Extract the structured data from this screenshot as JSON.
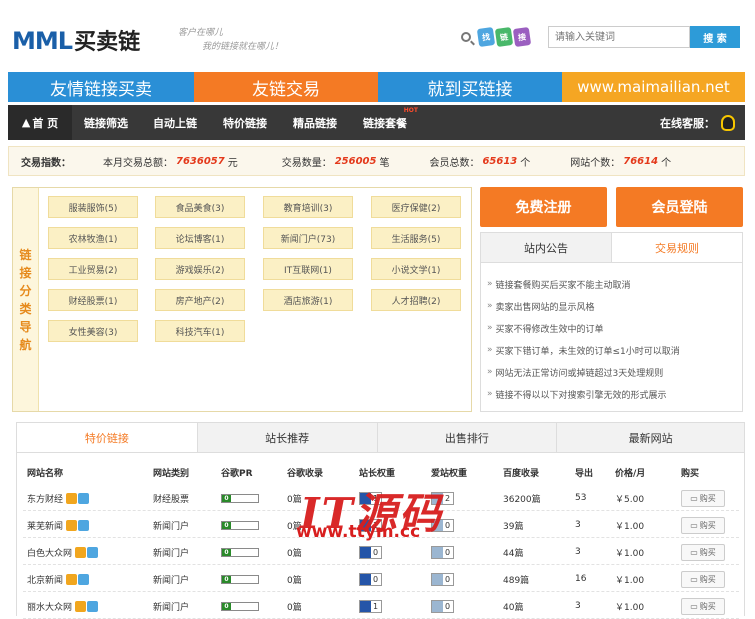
{
  "header": {
    "logo": "MML",
    "logo_cn": "买卖链",
    "slogan_1": "客户在哪儿",
    "slogan_2": "我的链接就在哪儿！",
    "pills": [
      "找",
      "链",
      "接"
    ],
    "search_placeholder": "请输入关键词",
    "search_button": "搜 索"
  },
  "banners": [
    {
      "label": "友情链接买卖",
      "color": "#2a8fd6"
    },
    {
      "label": "友链交易",
      "color": "#f47a24"
    },
    {
      "label": "就到买链接",
      "color": "#2a8fd6"
    },
    {
      "label": "www.maimailian.net",
      "color": "#f5a623"
    }
  ],
  "nav": {
    "home": "首 页",
    "items": [
      "链接筛选",
      "自动上链",
      "特价链接",
      "精品链接",
      "链接套餐"
    ],
    "hot": "HOT",
    "service": "在线客服："
  },
  "stats": {
    "label": "交易指数：",
    "month_total_label": "本月交易总额：",
    "month_total": "7636057",
    "month_unit": "元",
    "count_label": "交易数量：",
    "count": "256005",
    "count_unit": "笔",
    "members_label": "会员总数：",
    "members": "65613",
    "members_unit": "个",
    "sites_label": "网站个数：",
    "sites": "76614",
    "sites_unit": "个"
  },
  "categories": {
    "side_label": "链接分类导航",
    "items": [
      "服装服饰(5)",
      "食品美食(3)",
      "教育培训(3)",
      "医疗保健(2)",
      "农林牧渔(1)",
      "论坛博客(1)",
      "新闻门户(73)",
      "生活服务(5)",
      "工业贸易(2)",
      "游戏娱乐(2)",
      "IT互联网(1)",
      "小说文学(1)",
      "财经股票(1)",
      "房产地产(2)",
      "酒店旅游(1)",
      "人才招聘(2)",
      "女性美容(3)",
      "科技汽车(1)"
    ]
  },
  "right_panel": {
    "register": "免费注册",
    "login": "会员登陆",
    "tabs": [
      "站内公告",
      "交易规则"
    ],
    "rules": [
      "链接套餐购买后买家不能主动取消",
      "卖家出售网站的显示风格",
      "买家不得修改生效中的订单",
      "买家下错订单，未生效的订单≤1小时可以取消",
      "网站无法正常访问或掉链超过3天处理规则",
      "链接不得以以下对搜索引擎无效的形式展示"
    ]
  },
  "table": {
    "tabs": [
      "特价链接",
      "站长推荐",
      "出售排行",
      "最新网站"
    ],
    "headers": [
      "网站名称",
      "网站类别",
      "谷歌PR",
      "谷歌收录",
      "站长权重",
      "爱站权重",
      "百度收录",
      "导出",
      "价格/月",
      "购买"
    ],
    "rows": [
      {
        "name": "东方财经",
        "category": "财经股票",
        "pr": "0",
        "google": "0篇",
        "zz": "1",
        "az": "2",
        "baidu": "36200篇",
        "export": "53",
        "price": "￥5.00",
        "buy": "购买"
      },
      {
        "name": "莱芜新闻",
        "category": "新闻门户",
        "pr": "0",
        "google": "0篇",
        "zz": "1",
        "az": "0",
        "baidu": "39篇",
        "export": "3",
        "price": "￥1.00",
        "buy": "购买"
      },
      {
        "name": "白色大众网",
        "category": "新闻门户",
        "pr": "0",
        "google": "0篇",
        "zz": "0",
        "az": "0",
        "baidu": "44篇",
        "export": "3",
        "price": "￥1.00",
        "buy": "购买"
      },
      {
        "name": "北京新闻",
        "category": "新闻门户",
        "pr": "0",
        "google": "0篇",
        "zz": "0",
        "az": "0",
        "baidu": "489篇",
        "export": "16",
        "price": "￥1.00",
        "buy": "购买"
      },
      {
        "name": "丽水大众网",
        "category": "新闻门户",
        "pr": "0",
        "google": "0篇",
        "zz": "1",
        "az": "0",
        "baidu": "40篇",
        "export": "3",
        "price": "￥1.00",
        "buy": "购买"
      }
    ]
  },
  "watermark": {
    "line1": "IT源码",
    "line2": "www.ttym.cc"
  }
}
